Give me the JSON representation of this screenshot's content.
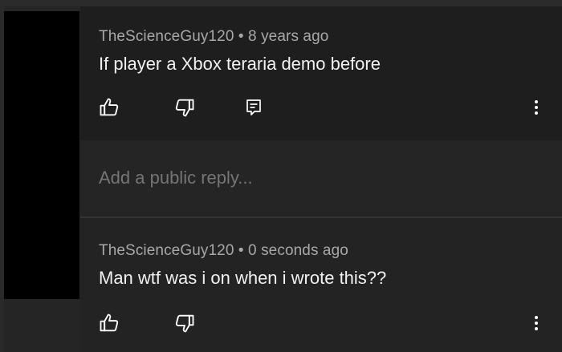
{
  "comments": [
    {
      "author": "TheScienceGuy120",
      "separator": "•",
      "time": "8 years ago",
      "text": "If player a Xbox teraria demo before"
    },
    {
      "author": "TheScienceGuy120",
      "separator": "•",
      "time": "0 seconds ago",
      "text": "Man wtf was i on when i wrote this??"
    }
  ],
  "reply": {
    "placeholder": "Add a public reply..."
  },
  "icons": {
    "like": "thumbs-up-icon",
    "dislike": "thumbs-down-icon",
    "reply": "comment-icon",
    "more": "more-vertical-icon"
  },
  "colors": {
    "background": "#252525",
    "highlighted_comment": "#1e1e1e",
    "meta_text": "#a8a8a8",
    "body_text": "#f1f1f1",
    "placeholder_text": "#9a9a9a",
    "icon": "#ffffff"
  }
}
